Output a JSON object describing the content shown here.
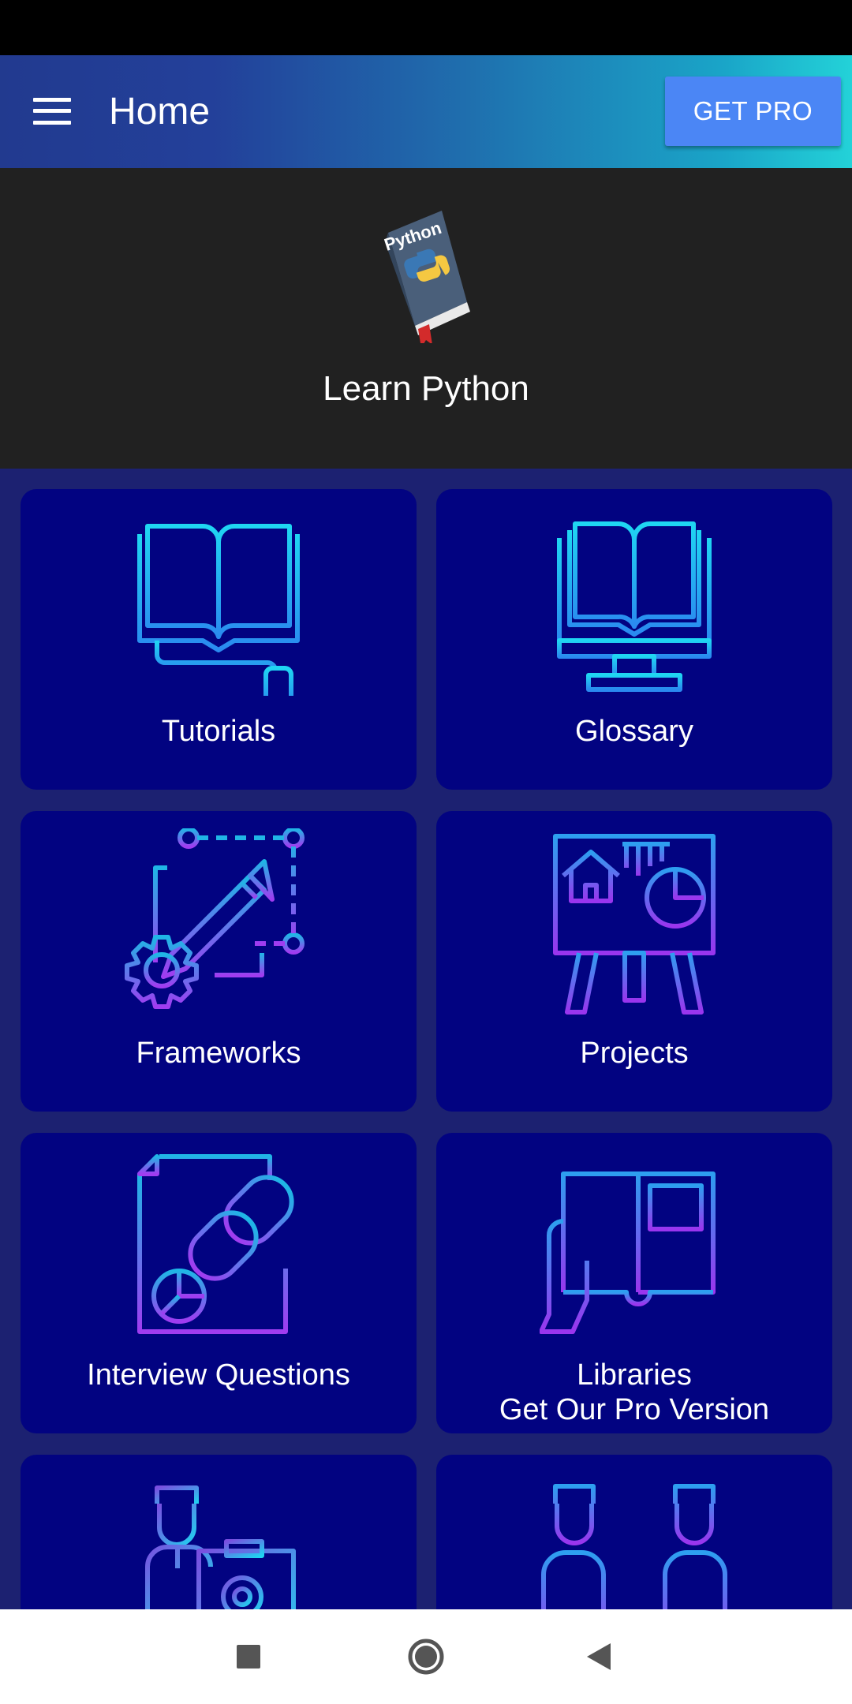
{
  "app_bar": {
    "title": "Home",
    "get_pro_label": "GET PRO"
  },
  "header": {
    "logo_text": "Python",
    "title": "Learn Python"
  },
  "cards": [
    {
      "label": "Tutorials",
      "icon": "open-book-mouse-icon"
    },
    {
      "label": "Glossary",
      "icon": "book-monitor-icon"
    },
    {
      "label": "Frameworks",
      "icon": "pencil-gear-icon"
    },
    {
      "label": "Projects",
      "icon": "presentation-board-icon"
    },
    {
      "label": "Interview Questions",
      "icon": "document-link-icon"
    },
    {
      "label": "Libraries",
      "sublabel": "Get Our Pro Version",
      "icon": "hand-book-icon"
    },
    {
      "label": "",
      "icon": "person-dashboard-icon"
    },
    {
      "label": "",
      "icon": "two-people-icon"
    }
  ],
  "colors": {
    "app_bar_start": "#223a8f",
    "app_bar_end": "#23d2d8",
    "get_pro": "#4b86f5",
    "card_bg": "#020381",
    "page_bg": "#1c2171",
    "header_bg": "#212121",
    "icon_cyan": "#1fd3f0",
    "icon_purple": "#a03cf0"
  },
  "nav": {
    "items": [
      "recents-icon",
      "home-icon",
      "back-icon"
    ]
  }
}
